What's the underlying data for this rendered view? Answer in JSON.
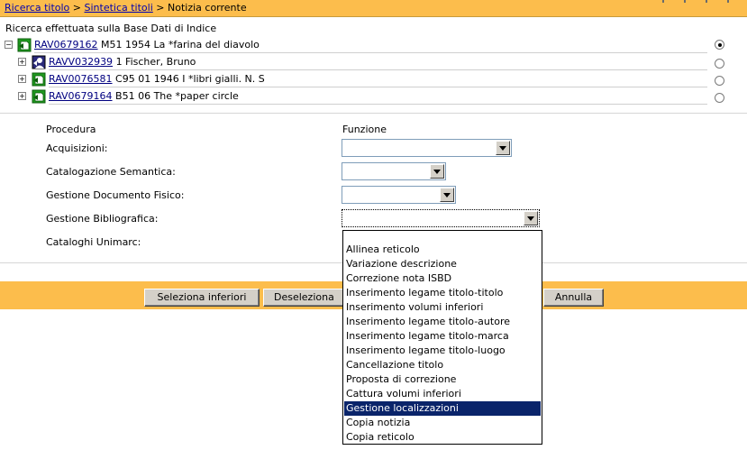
{
  "breadcrumb": {
    "items": [
      "Ricerca titolo",
      "Sintetica titoli",
      "Notizia corrente"
    ],
    "separator": ">"
  },
  "search_info": "Ricerca effettuata sulla Base Dati di Indice",
  "tree": {
    "rows": [
      {
        "expander": "−",
        "code": "RAV0679162",
        "desc": "M51 1954 La *farina del diavolo",
        "icon": "document-icon",
        "selected": true
      },
      {
        "expander": "+",
        "code": "RAVV032939",
        "desc": "1 Fischer, Bruno",
        "icon": "author-icon",
        "selected": false
      },
      {
        "expander": "+",
        "code": "RAV0076581",
        "desc": "C95 01 1946 I *libri gialli. N. S",
        "icon": "document-icon",
        "selected": false
      },
      {
        "expander": "+",
        "code": "RAV0679164",
        "desc": "B51 06 The *paper circle",
        "icon": "document-icon",
        "selected": false
      }
    ]
  },
  "form": {
    "col_procedura": "Procedura",
    "col_funzione": "Funzione",
    "fields": [
      {
        "label": "Acquisizioni:",
        "value": ""
      },
      {
        "label": "Catalogazione Semantica:",
        "value": ""
      },
      {
        "label": "Gestione Documento Fisico:",
        "value": ""
      },
      {
        "label": "Gestione Bibliografica:",
        "value": ""
      },
      {
        "label": "Cataloghi Unimarc:",
        "value": ""
      }
    ]
  },
  "buttons": {
    "seleziona_inferiori": "Seleziona inferiori",
    "deseleziona": "Deseleziona",
    "annulla": "Annulla"
  },
  "dropdown": {
    "options": [
      "",
      "Allinea reticolo",
      "Variazione descrizione",
      "Correzione nota ISBD",
      "Inserimento legame titolo-titolo",
      "Inserimento volumi inferiori",
      "Inserimento legame titolo-autore",
      "Inserimento legame titolo-marca",
      "Inserimento legame titolo-luogo",
      "Cancellazione titolo",
      "Proposta di correzione",
      "Cattura volumi inferiori",
      "Gestione localizzazioni",
      "Copia notizia",
      "Copia reticolo"
    ],
    "highlighted": "Gestione localizzazioni"
  },
  "colors": {
    "bar": "#fcbd4c",
    "link": "#000080",
    "highlight": "#0a246a"
  }
}
